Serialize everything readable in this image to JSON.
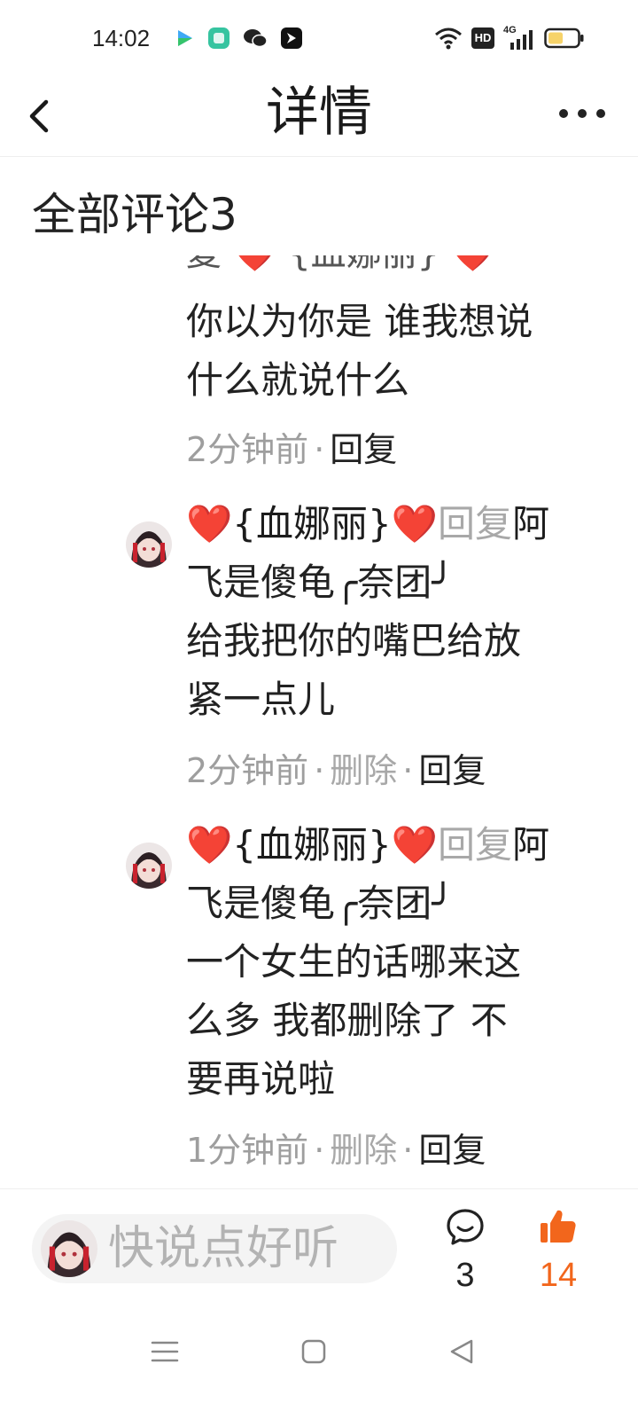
{
  "status_bar": {
    "time": "14:02",
    "hd_label": "HD",
    "network": "4G",
    "icons": [
      "video-app-icon",
      "green-app-icon",
      "wechat-icon",
      "feishu-icon",
      "wifi-icon",
      "hd-icon",
      "signal-4g-icon",
      "battery-icon"
    ]
  },
  "header": {
    "title": "详情",
    "back_icon": "chevron-left-icon",
    "more_icon": "more-dots-icon"
  },
  "section": {
    "title": "全部评论3"
  },
  "scroll_remnant": "复 ❤️ {血娜丽} ❤️",
  "comments": [
    {
      "text_lines": [
        "你以为你是 谁我想说",
        "什么就说什么"
      ],
      "time": "2分钟前",
      "reply": "回复"
    },
    {
      "author": "❤️{血娜丽}❤️",
      "reply_word": "回复",
      "target": "阿",
      "target_line2": "飞是傻龟╭奈团╯",
      "text_lines": [
        "给我把你的嘴巴给放",
        "紧一点儿"
      ],
      "time": "2分钟前",
      "delete": "删除",
      "reply": "回复"
    },
    {
      "author": "❤️{血娜丽}❤️",
      "reply_word": "回复",
      "target": "阿",
      "target_line2": "飞是傻龟╭奈团╯",
      "text_lines": [
        "一个女生的话哪来这",
        "么多 我都删除了 不",
        "要再说啦"
      ],
      "time": "1分钟前",
      "delete": "删除",
      "reply": "回复"
    }
  ],
  "bottom_bar": {
    "placeholder": "快说点好听",
    "comment_count": "3",
    "like_count": "14",
    "like_color": "#f2661c"
  },
  "nav": {
    "icons": [
      "menu-icon",
      "home-square-icon",
      "back-triangle-icon"
    ]
  }
}
